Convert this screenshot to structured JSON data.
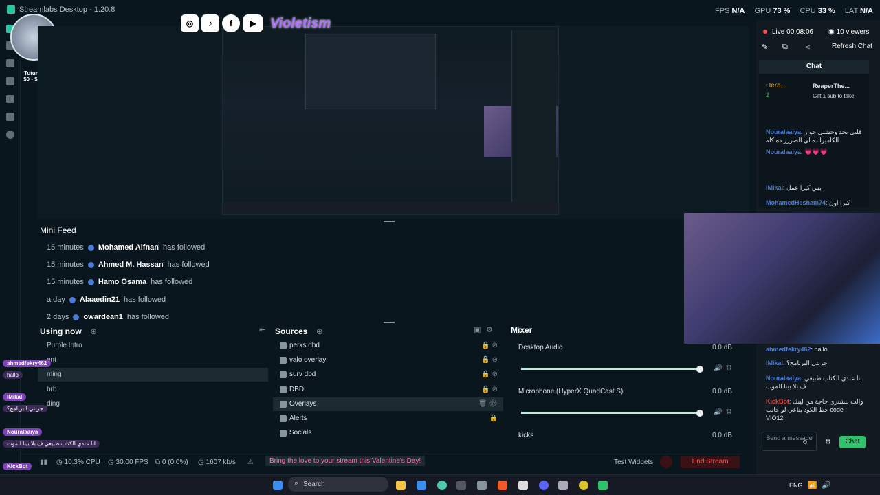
{
  "titlebar": {
    "app_title": "Streamlabs Desktop - 1.20.8"
  },
  "perf": {
    "fps_label": "FPS",
    "fps": "N/A",
    "gpu_label": "GPU",
    "gpu": "73 %",
    "cpu_label": "CPU",
    "cpu": "33 %",
    "lat_label": "LAT",
    "lat": "N/A"
  },
  "overlay": {
    "social_icons": [
      "instagram-icon",
      "tiktok-icon",
      "facebook-icon",
      "youtube-icon"
    ],
    "brand": "Violetism",
    "wheel_title": "Tuturool",
    "wheel_sub": "$0 - $100"
  },
  "minifeed": {
    "title": "Mini Feed",
    "items": [
      {
        "time": "15 minutes",
        "name": "Mohamed Alfnan",
        "action": "has followed"
      },
      {
        "time": "15 minutes",
        "name": "Ahmed M. Hassan",
        "action": "has followed"
      },
      {
        "time": "15 minutes",
        "name": "Hamo Osama",
        "action": "has followed"
      },
      {
        "time": "a day",
        "name": "Alaaedin21",
        "action": "has followed"
      },
      {
        "time": "2 days",
        "name": "owardean1",
        "action": "has followed"
      }
    ]
  },
  "scenes": {
    "title": "Using now",
    "items": [
      "Purple Intro",
      "ent",
      "ming",
      "brb",
      "ding"
    ]
  },
  "sources": {
    "title": "Sources",
    "items": [
      "perks dbd",
      "valo overlay",
      "surv dbd",
      "DBD",
      "Overlays",
      "Alerts",
      "Socials"
    ]
  },
  "mixer": {
    "title": "Mixer",
    "items": [
      {
        "name": "Desktop Audio",
        "db": "0.0 dB",
        "level": 0.98
      },
      {
        "name": "Microphone (HyperX QuadCast S)",
        "db": "0.0 dB",
        "level": 0.98
      },
      {
        "name": "kicks",
        "db": "0.0 dB",
        "level": 0.0
      }
    ]
  },
  "statusbar": {
    "cpu": "10.3% CPU",
    "fps": "30.00 FPS",
    "dropped": "0 (0.0%)",
    "kbps": "1607 kb/s",
    "promo": "Bring the love to your stream this Valentine's Day!",
    "test_widgets": "Test Widgets",
    "end_stream": "End Stream"
  },
  "chat": {
    "live_label": "Live",
    "live_time": "00:08:06",
    "viewers": "10 viewers",
    "refresh": "Refresh Chat",
    "title": "Chat",
    "pin_name": "Hera...",
    "pin_count": "2",
    "pin_user": "ReaperThe...",
    "pin_gift": "Gift 1 sub to take",
    "messages": [
      {
        "name": "Nouralaaiya",
        "text": "قلبي يجد وحشني حوار الكاميرا ده اي الصرزر ده كله"
      },
      {
        "name": "Nouralaaiya",
        "text": "💗💗💗"
      },
      {
        "name": "IMikal",
        "text": "بس كيرا عمل"
      },
      {
        "name": "MohamedHesham74",
        "text": "كيرا اون"
      },
      {
        "name": "ahmedfekry462",
        "text": "hallo"
      },
      {
        "name": "IMikal",
        "text": "جربتي البرنامج؟"
      },
      {
        "name": "Nouralaaiya",
        "text": "انا عندي الكتاب طبيعي ف بلا بينا الموت"
      },
      {
        "name": "KickBot",
        "text": "والت بتشتري حاجة من لينك حط الكود بتاعي لو حابب code : VIO12"
      }
    ],
    "input_placeholder": "Send a message",
    "send": "Chat"
  },
  "overlay_chat": [
    {
      "name": "ahmedfekry462",
      "msg": "hallo"
    },
    {
      "name": "IMikal",
      "msg": "جربتي البرنامج؟"
    },
    {
      "name": "Nouralaaiya",
      "msg": "انا عندي الكتاب طبيعي ف بلا بينا الموت"
    },
    {
      "name": "KickBot",
      "msg": "code : VIO12"
    }
  ],
  "taskbar": {
    "search": "Search",
    "lang": "ENG"
  },
  "colors": {
    "accent": "#31c26d",
    "live": "#ff4d4d",
    "brand": "#b06cff"
  }
}
